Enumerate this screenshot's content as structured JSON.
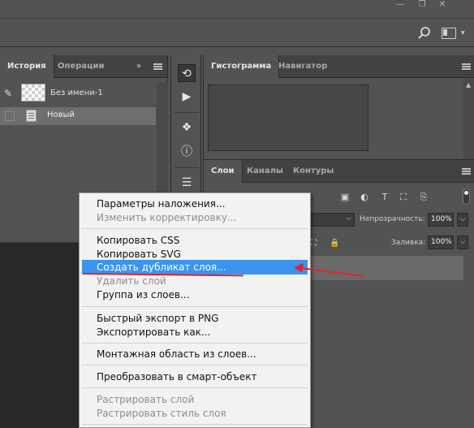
{
  "window": {
    "minimize": "—",
    "restore": "❐",
    "close": "✕"
  },
  "history_panel": {
    "tabs": [
      {
        "label": "История"
      },
      {
        "label": "Операции"
      }
    ],
    "tab_menu_glyph": "»",
    "snapshot_label": "Без имени-1",
    "states": [
      {
        "label": "Новый"
      }
    ]
  },
  "top_right_panel": {
    "tabs": [
      {
        "label": "Гистограмма"
      },
      {
        "label": "Навигатор"
      }
    ]
  },
  "layers_panel": {
    "tabs": [
      {
        "label": "Слои"
      },
      {
        "label": "Каналы"
      },
      {
        "label": "Контуры"
      }
    ],
    "opacity_label": "Непрозрачность:",
    "opacity_value": "100%",
    "fill_label": "Заливка:",
    "fill_value": "100%"
  },
  "context_menu": {
    "items": [
      {
        "label": "Параметры наложения...",
        "disabled": false
      },
      {
        "label": "Изменить корректировку...",
        "disabled": true
      },
      {
        "label": "Копировать CSS",
        "disabled": false
      },
      {
        "label": "Копировать SVG",
        "disabled": false
      },
      {
        "label": "Создать дубликат слоя...",
        "disabled": false,
        "highlighted": true
      },
      {
        "label": "Удалить слой",
        "disabled": true
      },
      {
        "label": "Группа из слоев...",
        "disabled": false
      },
      {
        "label": "Быстрый экспорт в PNG",
        "disabled": false
      },
      {
        "label": "Экспортировать как...",
        "disabled": false
      },
      {
        "label": "Монтажная область из слоев...",
        "disabled": false
      },
      {
        "label": "Преобразовать в смарт-объект",
        "disabled": false
      },
      {
        "label": "Растрировать слой",
        "disabled": true
      },
      {
        "label": "Растрировать стиль слоя",
        "disabled": true
      }
    ]
  },
  "colors": {
    "panel_bg": "#535353",
    "menu_highlight": "#3b95ee",
    "annotation_red": "#e0242a"
  }
}
